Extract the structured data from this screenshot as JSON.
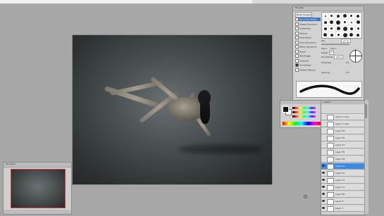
{
  "navigator": {
    "title": "Navigator"
  },
  "brushes": {
    "title": "Brushes",
    "preset_button": "Brush Presets",
    "options": [
      {
        "label": "Brush Tip Shape",
        "checked": false,
        "selected": true
      },
      {
        "label": "Shape Dynamics",
        "checked": false,
        "selected": false
      },
      {
        "label": "Scattering",
        "checked": false,
        "selected": false
      },
      {
        "label": "Texture",
        "checked": false,
        "selected": false
      },
      {
        "label": "Dual Brush",
        "checked": false,
        "selected": false
      },
      {
        "label": "Color Dynamics",
        "checked": false,
        "selected": false
      },
      {
        "label": "Other Dynamics",
        "checked": false,
        "selected": false
      },
      {
        "label": "Noise",
        "checked": false,
        "selected": false
      },
      {
        "label": "Wet Edges",
        "checked": false,
        "selected": false
      },
      {
        "label": "Airbrush",
        "checked": false,
        "selected": false
      },
      {
        "label": "Smoothing",
        "checked": true,
        "selected": false
      },
      {
        "label": "Protect Texture",
        "checked": false,
        "selected": false
      }
    ],
    "size_label": "Dia",
    "size_value": "27 px",
    "flip_x": "Flip X",
    "flip_y": "Flip Y",
    "angle_label": "Angle:",
    "angle_value": "0°",
    "roundness_label": "Roundness:",
    "roundness_value": "100%",
    "hardness_label": "Hardness",
    "hardness_value": "0%",
    "spacing_label": "Spacing",
    "spacing_value": "1%"
  },
  "layers": {
    "tabs": "Layers",
    "rows": [
      {
        "name": "Layer 5 copy",
        "visible": false,
        "selected": false
      },
      {
        "name": "Layer 5 copy",
        "visible": false,
        "selected": false
      },
      {
        "name": "Layer 58",
        "visible": false,
        "selected": false
      },
      {
        "name": "Layer 56",
        "visible": false,
        "selected": false
      },
      {
        "name": "Layer 57",
        "visible": false,
        "selected": false
      },
      {
        "name": "Layer 55",
        "visible": false,
        "selected": false
      },
      {
        "name": "Layer 54",
        "visible": false,
        "selected": false
      },
      {
        "name": "Layer 53",
        "visible": true,
        "selected": true
      },
      {
        "name": "Layer 52",
        "visible": true,
        "selected": false
      },
      {
        "name": "Layer 51",
        "visible": true,
        "selected": false
      },
      {
        "name": "Layer 11",
        "visible": true,
        "selected": false
      },
      {
        "name": "Layer 50",
        "visible": true,
        "selected": false
      },
      {
        "name": "Layer 8",
        "visible": true,
        "selected": false
      },
      {
        "name": "Layer 7",
        "visible": true,
        "selected": false
      }
    ]
  }
}
